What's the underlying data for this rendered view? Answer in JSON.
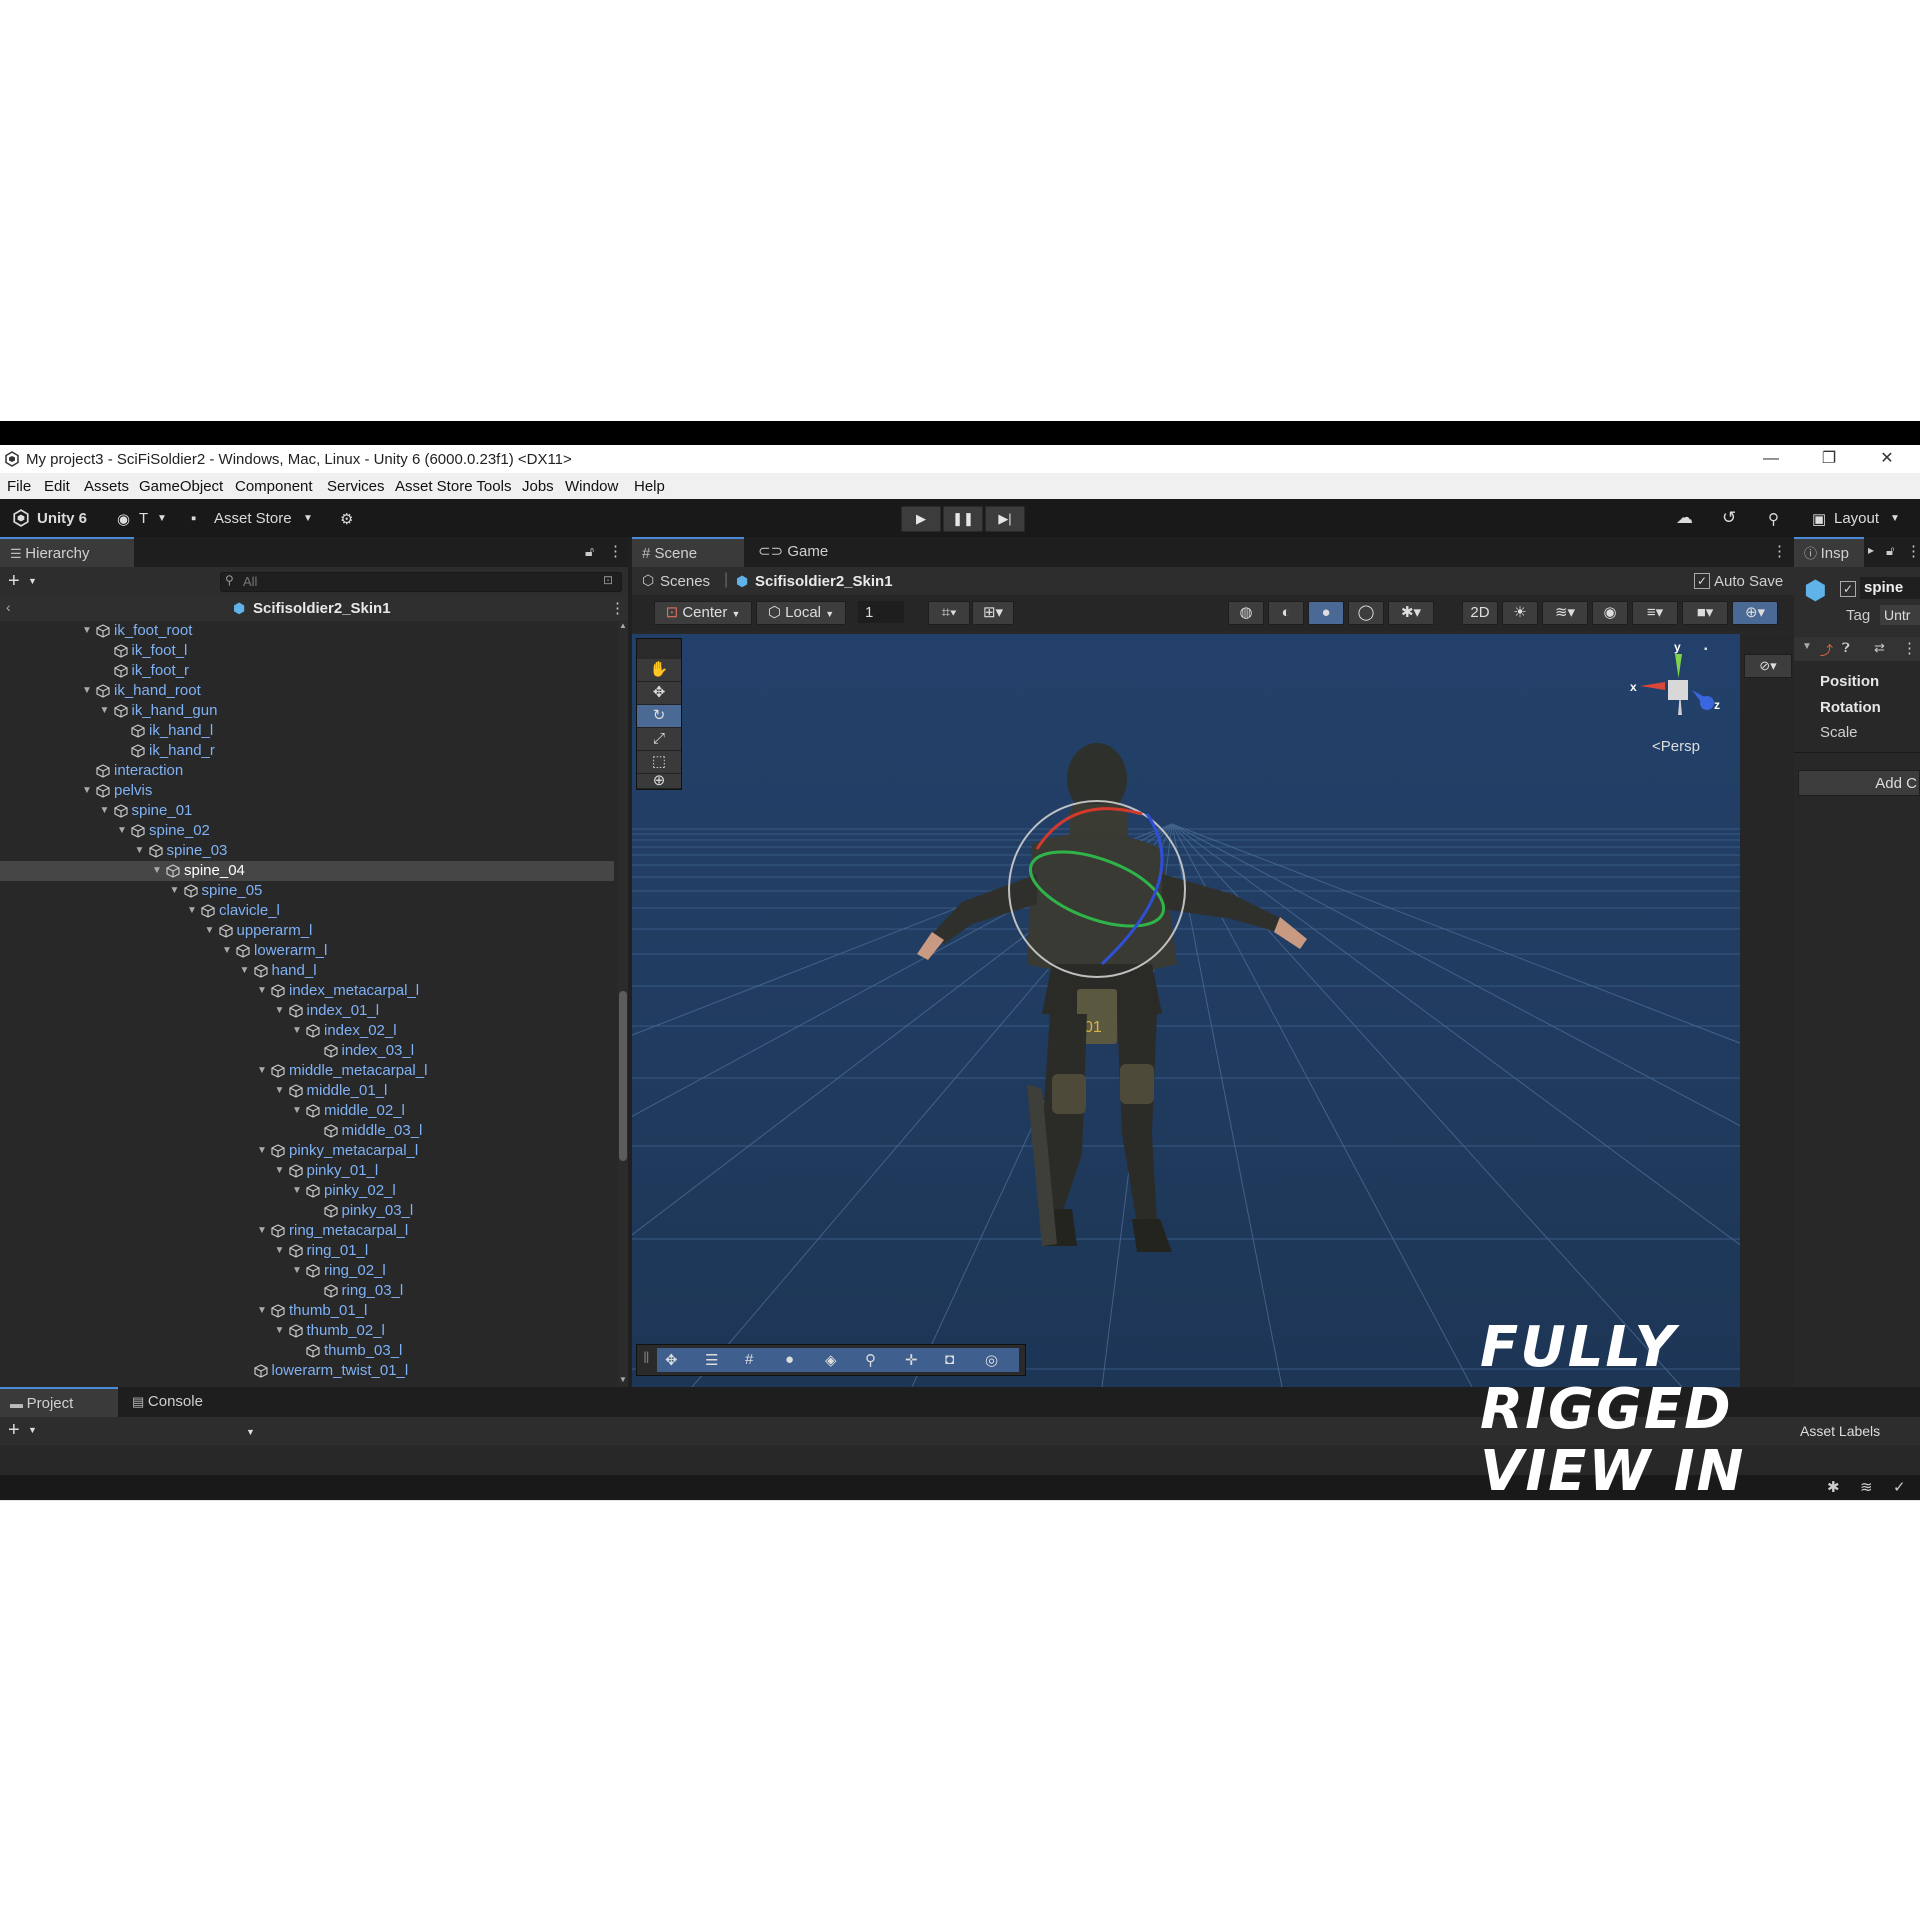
{
  "window": {
    "title": "My project3 - SciFiSoldier2 - Windows, Mac, Linux - Unity 6 (6000.0.23f1) <DX11>",
    "minimize": "—",
    "restore": "❐",
    "close": "✕"
  },
  "menu": [
    "File",
    "Edit",
    "Assets",
    "GameObject",
    "Component",
    "Services",
    "Asset Store Tools",
    "Jobs",
    "Window",
    "Help"
  ],
  "toolbar": {
    "unity_label": "Unity 6",
    "account_label": "T",
    "asset_store_label": "Asset Store",
    "layout_label": "Layout",
    "play_icon": "play-icon",
    "pause_icon": "pause-icon",
    "step_icon": "step-icon"
  },
  "hierarchy": {
    "tab_label": "Hierarchy",
    "search_placeholder": "All",
    "scene_name": "Scifisoldier2_Skin1",
    "rows": [
      {
        "label": "ik_foot_root",
        "depth": 0,
        "arrow": true
      },
      {
        "label": "ik_foot_l",
        "depth": 1,
        "arrow": false
      },
      {
        "label": "ik_foot_r",
        "depth": 1,
        "arrow": false
      },
      {
        "label": "ik_hand_root",
        "depth": 0,
        "arrow": true
      },
      {
        "label": "ik_hand_gun",
        "depth": 1,
        "arrow": true
      },
      {
        "label": "ik_hand_l",
        "depth": 2,
        "arrow": false
      },
      {
        "label": "ik_hand_r",
        "depth": 2,
        "arrow": false
      },
      {
        "label": "interaction",
        "depth": 0,
        "arrow": false
      },
      {
        "label": "pelvis",
        "depth": 0,
        "arrow": true
      },
      {
        "label": "spine_01",
        "depth": 1,
        "arrow": true
      },
      {
        "label": "spine_02",
        "depth": 2,
        "arrow": true
      },
      {
        "label": "spine_03",
        "depth": 3,
        "arrow": true
      },
      {
        "label": "spine_04",
        "depth": 4,
        "arrow": true,
        "selected": true
      },
      {
        "label": "spine_05",
        "depth": 5,
        "arrow": true
      },
      {
        "label": "clavicle_l",
        "depth": 6,
        "arrow": true
      },
      {
        "label": "upperarm_l",
        "depth": 7,
        "arrow": true
      },
      {
        "label": "lowerarm_l",
        "depth": 8,
        "arrow": true
      },
      {
        "label": "hand_l",
        "depth": 9,
        "arrow": true
      },
      {
        "label": "index_metacarpal_l",
        "depth": 10,
        "arrow": true
      },
      {
        "label": "index_01_l",
        "depth": 11,
        "arrow": true
      },
      {
        "label": "index_02_l",
        "depth": 12,
        "arrow": true
      },
      {
        "label": "index_03_l",
        "depth": 13,
        "arrow": false
      },
      {
        "label": "middle_metacarpal_l",
        "depth": 10,
        "arrow": true
      },
      {
        "label": "middle_01_l",
        "depth": 11,
        "arrow": true
      },
      {
        "label": "middle_02_l",
        "depth": 12,
        "arrow": true
      },
      {
        "label": "middle_03_l",
        "depth": 13,
        "arrow": false
      },
      {
        "label": "pinky_metacarpal_l",
        "depth": 10,
        "arrow": true
      },
      {
        "label": "pinky_01_l",
        "depth": 11,
        "arrow": true
      },
      {
        "label": "pinky_02_l",
        "depth": 12,
        "arrow": true
      },
      {
        "label": "pinky_03_l",
        "depth": 13,
        "arrow": false
      },
      {
        "label": "ring_metacarpal_l",
        "depth": 10,
        "arrow": true
      },
      {
        "label": "ring_01_l",
        "depth": 11,
        "arrow": true
      },
      {
        "label": "ring_02_l",
        "depth": 12,
        "arrow": true
      },
      {
        "label": "ring_03_l",
        "depth": 13,
        "arrow": false
      },
      {
        "label": "thumb_01_l",
        "depth": 10,
        "arrow": true
      },
      {
        "label": "thumb_02_l",
        "depth": 11,
        "arrow": true
      },
      {
        "label": "thumb_03_l",
        "depth": 12,
        "arrow": false
      },
      {
        "label": "lowerarm_twist_01_l",
        "depth": 9,
        "arrow": false
      }
    ]
  },
  "scene": {
    "tab_scene": "Scene",
    "tab_game": "Game",
    "breadcrumb_root": "Scenes",
    "breadcrumb_object": "Scifisoldier2_Skin1",
    "auto_save": "Auto Save",
    "pivot_mode": "Center",
    "pivot_rotation": "Local",
    "grid_value": "1",
    "projection": "Persp",
    "axis_x": "x",
    "axis_y": "y",
    "axis_z": "z",
    "badge_text": "01"
  },
  "inspector": {
    "tab_label": "Insp",
    "object_name": "spine",
    "tag_label": "Tag",
    "tag_value": "Untr",
    "position_label": "Position",
    "rotation_label": "Rotation",
    "scale_label": "Scale",
    "add_component": "Add C"
  },
  "bottom": {
    "project_tab": "Project",
    "console_tab": "Console",
    "asset_labels": "Asset Labels"
  },
  "overlay": {
    "line1": "FULLY RIGGED",
    "line2": "VIEW IN UNITY"
  },
  "colors": {
    "accent": "#4a8ad6",
    "hierarchy_link": "#7fb1f5",
    "viewport_bg": "#213a5a"
  }
}
